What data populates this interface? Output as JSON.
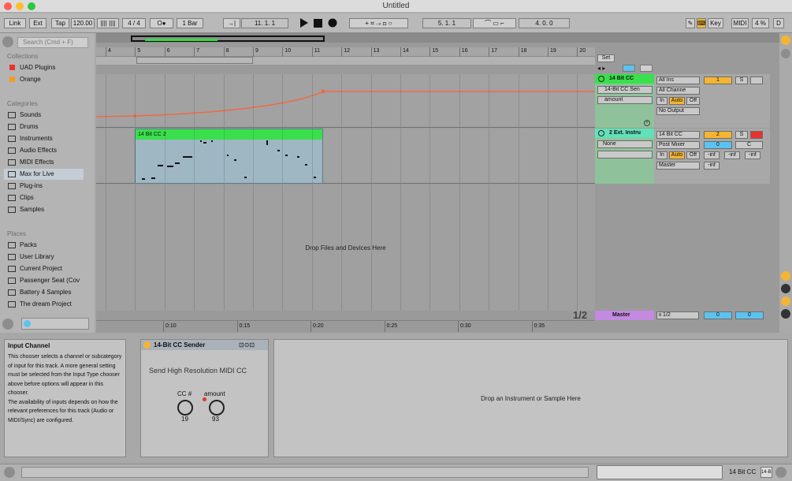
{
  "window": {
    "title": "Untitled"
  },
  "control_bar": {
    "link": "Link",
    "ext": "Ext",
    "tap": "Tap",
    "tempo": "120.00",
    "metronome": "||||  ||||",
    "time_signature": "4 / 4",
    "overdub": "O●",
    "quantize": "1 Bar",
    "position": "11.  1.  1",
    "punch_start": "5.  1.  1",
    "loop_length": "4.  0.  0",
    "key": "Key",
    "midi": "MIDI",
    "cpu": "4 %",
    "d_indicator": "D"
  },
  "browser": {
    "search_placeholder": "Search (Cmd + F)",
    "collections_header": "Collections",
    "collections": [
      {
        "label": "UAD Plugins",
        "color": "#e8322d"
      },
      {
        "label": "Orange",
        "color": "#f39c21"
      }
    ],
    "categories_header": "Categories",
    "categories": [
      "Sounds",
      "Drums",
      "Instruments",
      "Audio Effects",
      "MIDI Effects",
      "Max for Live",
      "Plug-ins",
      "Clips",
      "Samples"
    ],
    "places_header": "Places",
    "places": [
      "Packs",
      "User Library",
      "Current Project",
      "Passenger Seat (Cov",
      "Battery 4 Samples",
      "The dream Project"
    ]
  },
  "ruler": {
    "bars": [
      "4",
      "5",
      "6",
      "7",
      "8",
      "9",
      "10",
      "11",
      "12",
      "13",
      "14",
      "15",
      "16",
      "17",
      "18",
      "19",
      "20"
    ]
  },
  "bottom_ruler": {
    "times": [
      "0:10",
      "0:15",
      "0:20",
      "0:25",
      "0:30",
      "0:35"
    ],
    "page": "1/2"
  },
  "arrangement": {
    "drop_text": "Drop Files and Devices Here",
    "set_label": "Set",
    "clip_name": "14 Bit CC 2"
  },
  "tracks": [
    {
      "name": "14 Bit CC",
      "color": "#39d94a",
      "device_chooser": "14-Bit CC Sen",
      "param_chooser": "amount",
      "input_type": "All Ins",
      "input_channel": "All Channe",
      "output": "No Output",
      "in": "In",
      "auto": "Auto",
      "off": "Off",
      "track_number": "1",
      "solo": "S"
    },
    {
      "name": "2 Ext. Instru",
      "color": "#39d94a",
      "device_chooser": "None",
      "input_type": "14 Bit CC",
      "input_channel": "Post Mixer",
      "output": "Master",
      "in": "In",
      "auto": "Auto",
      "off": "Off",
      "track_number": "2",
      "solo": "S",
      "volume": "0",
      "pan": "C",
      "send_a": "-inf",
      "send_b": "-inf",
      "send_c": "-inf",
      "send_d": "-inf"
    },
    {
      "name": "Master",
      "color": "#c38ae1",
      "output": "ii 1/2",
      "volume": "0",
      "pan": "0"
    }
  ],
  "info_view": {
    "title": "Input Channel",
    "text": "This chooser selects a channel or subcategory of input for this track. A more general setting must be selected from the Input Type chooser above before options will appear in this chooser.\nThe availability of inputs depends on how the relevant preferences for this track (Audio or MIDI/Sync) are configured."
  },
  "device": {
    "title": "14-Bit CC Sender",
    "subtitle": "Send High Resolution MIDI CC",
    "knobs": [
      {
        "label": "CC #",
        "value": "19"
      },
      {
        "label": "amount",
        "value": "93"
      }
    ]
  },
  "device_drop": {
    "text": "Drop an Instrument or Sample Here"
  },
  "status": {
    "track": "14 Bit CC",
    "extra": "14-B"
  }
}
